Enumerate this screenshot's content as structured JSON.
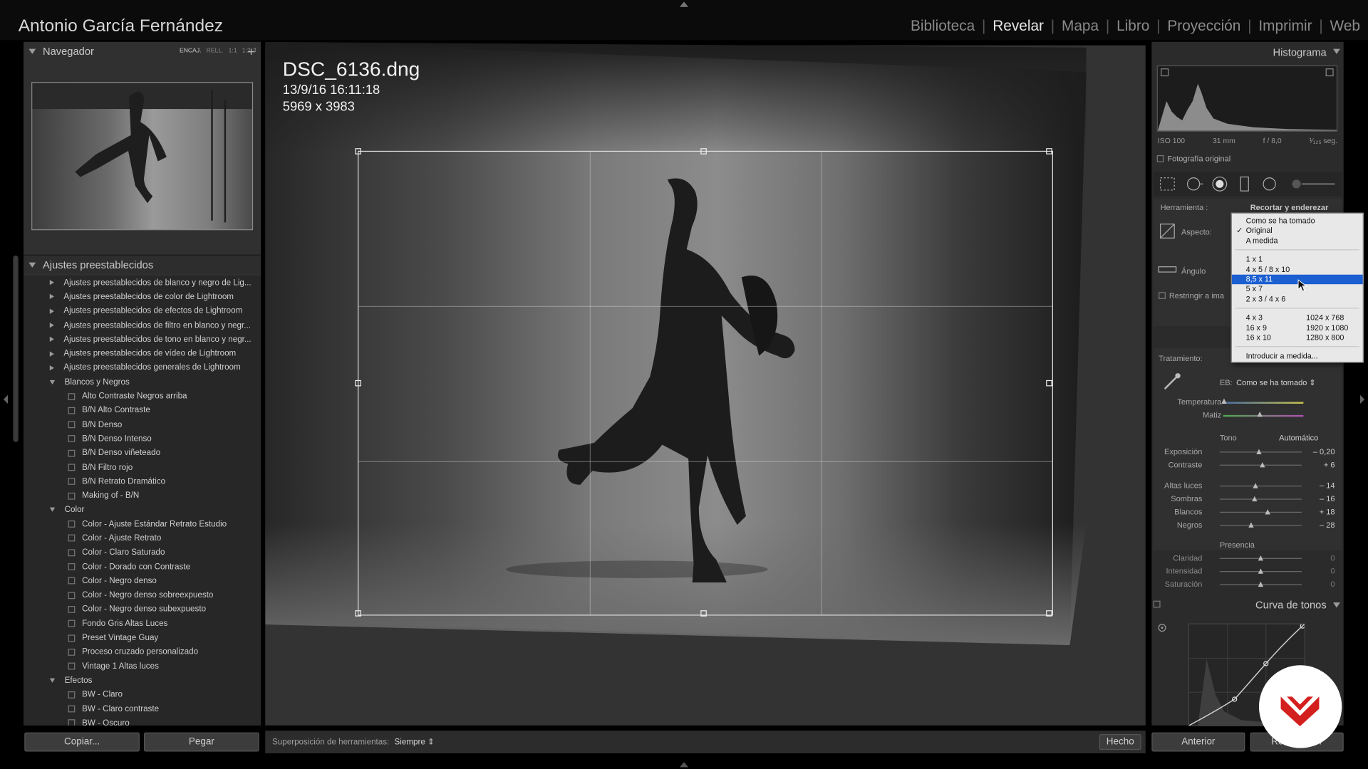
{
  "identity": "Antonio García Fernández",
  "modules": [
    "Biblioteca",
    "Revelar",
    "Mapa",
    "Libro",
    "Proyección",
    "Imprimir",
    "Web"
  ],
  "active_module": "Revelar",
  "navigator": {
    "title": "Navegador",
    "options": [
      "ENCAJ.",
      "RELL.",
      "1:1",
      "1:2"
    ]
  },
  "presets": {
    "title": "Ajustes preestablecidos",
    "add_label": "+",
    "items": [
      {
        "kind": "folder",
        "label": "Ajustes preestablecidos de blanco y negro de Lig..."
      },
      {
        "kind": "folder",
        "label": "Ajustes preestablecidos de color de Lightroom"
      },
      {
        "kind": "folder",
        "label": "Ajustes preestablecidos de efectos de Lightroom"
      },
      {
        "kind": "folder",
        "label": "Ajustes preestablecidos de filtro en blanco y negr..."
      },
      {
        "kind": "folder",
        "label": "Ajustes preestablecidos de tono en blanco y negr..."
      },
      {
        "kind": "folder",
        "label": "Ajustes preestablecidos de vídeo de Lightroom"
      },
      {
        "kind": "folder",
        "label": "Ajustes preestablecidos generales de Lightroom"
      },
      {
        "kind": "open",
        "label": "Blancos y Negros"
      },
      {
        "kind": "item",
        "label": "Alto Contraste Negros arriba"
      },
      {
        "kind": "item",
        "label": "B/N Alto Contraste"
      },
      {
        "kind": "item",
        "label": "B/N Denso"
      },
      {
        "kind": "item",
        "label": "B/N Denso Intenso"
      },
      {
        "kind": "item",
        "label": "B/N Denso viñeteado"
      },
      {
        "kind": "item",
        "label": "B/N Filtro rojo"
      },
      {
        "kind": "item",
        "label": "B/N Retrato Dramático"
      },
      {
        "kind": "item",
        "label": "Making of - B/N"
      },
      {
        "kind": "open",
        "label": "Color"
      },
      {
        "kind": "item",
        "label": "Color - Ajuste Estándar Retrato Estudio"
      },
      {
        "kind": "item",
        "label": "Color - Ajuste Retrato"
      },
      {
        "kind": "item",
        "label": "Color - Claro Saturado"
      },
      {
        "kind": "item",
        "label": "Color - Dorado con Contraste"
      },
      {
        "kind": "item",
        "label": "Color - Negro denso"
      },
      {
        "kind": "item",
        "label": "Color - Negro denso sobreexpuesto"
      },
      {
        "kind": "item",
        "label": "Color - Negro denso subexpuesto"
      },
      {
        "kind": "item",
        "label": "Fondo Gris Altas Luces"
      },
      {
        "kind": "item",
        "label": "Preset Vintage Guay"
      },
      {
        "kind": "item",
        "label": "Proceso cruzado personalizado"
      },
      {
        "kind": "item",
        "label": "Vintage 1 Altas luces"
      },
      {
        "kind": "open",
        "label": "Efectos"
      },
      {
        "kind": "item",
        "label": "BW - Claro"
      },
      {
        "kind": "item",
        "label": "BW - Claro contraste"
      },
      {
        "kind": "item",
        "label": "BW - Oscuro"
      }
    ]
  },
  "buttons": {
    "copy": "Copiar...",
    "paste": "Pegar",
    "done": "Hecho",
    "previous": "Anterior",
    "reset": "Restablecer"
  },
  "photo": {
    "filename": "DSC_6136.dng",
    "datetime": "13/9/16 16:11:18",
    "dimensions": "5969 x 3983"
  },
  "toolbar": {
    "overlay_label": "Superposición de herramientas:",
    "overlay_value": "Siempre"
  },
  "histogram": {
    "title": "Histograma",
    "iso": "ISO 100",
    "focal": "31 mm",
    "aperture": "f / 8,0",
    "shutter": "¹⁄₁₂₅ seg.",
    "original_photo_label": "Fotografía original"
  },
  "crop": {
    "tool_label": "Herramienta :",
    "tool_name": "Recortar y enderezar",
    "aspect_label": "Aspecto:",
    "angle_label": "Ángulo",
    "constrain_label": "Restringir a ima"
  },
  "aspect_menu": {
    "groups": [
      [
        {
          "label": "Como se ha tomado",
          "right": ""
        },
        {
          "label": "Original",
          "right": "",
          "checked": true
        },
        {
          "label": "A medida",
          "right": ""
        }
      ],
      [
        {
          "label": "1 x 1",
          "right": ""
        },
        {
          "label": "4 x 5  /  8 x 10",
          "right": ""
        },
        {
          "label": "8,5 x 11",
          "right": "",
          "selected": true
        },
        {
          "label": "5 x 7",
          "right": ""
        },
        {
          "label": "2 x 3  /  4 x 6",
          "right": ""
        }
      ],
      [
        {
          "label": "4 x 3",
          "right": "1024 x 768"
        },
        {
          "label": "16 x 9",
          "right": "1920 x 1080"
        },
        {
          "label": "16 x 10",
          "right": "1280 x 800"
        }
      ],
      [
        {
          "label": "Introducir a medida...",
          "right": ""
        }
      ]
    ],
    "check_mark": "✓"
  },
  "treatment": {
    "label": "Tratamiento:",
    "wb_label": "EB:",
    "wb_value": "Como se ha tomado",
    "temperature_label": "Temperatura",
    "tint_label": "Matiz",
    "tone_label": "Tono",
    "auto_label": "Automático",
    "sliders": [
      {
        "label": "Exposición",
        "value": "– 0,20",
        "level": 0.48
      },
      {
        "label": "Contraste",
        "value": "+ 6",
        "level": 0.52
      },
      {
        "label": "Altas luces",
        "value": "– 14",
        "level": 0.44
      },
      {
        "label": "Sombras",
        "value": "– 16",
        "level": 0.43
      },
      {
        "label": "Blancos",
        "value": "+ 18",
        "level": 0.58
      },
      {
        "label": "Negros",
        "value": "– 28",
        "level": 0.38
      }
    ],
    "presence_label": "Presencia",
    "presence": [
      {
        "label": "Claridad",
        "value": "0",
        "level": 0.5
      },
      {
        "label": "Intensidad",
        "value": "0",
        "level": 0.5
      },
      {
        "label": "Saturación",
        "value": "0",
        "level": 0.5
      }
    ]
  },
  "curve": {
    "title": "Curva de tonos"
  }
}
